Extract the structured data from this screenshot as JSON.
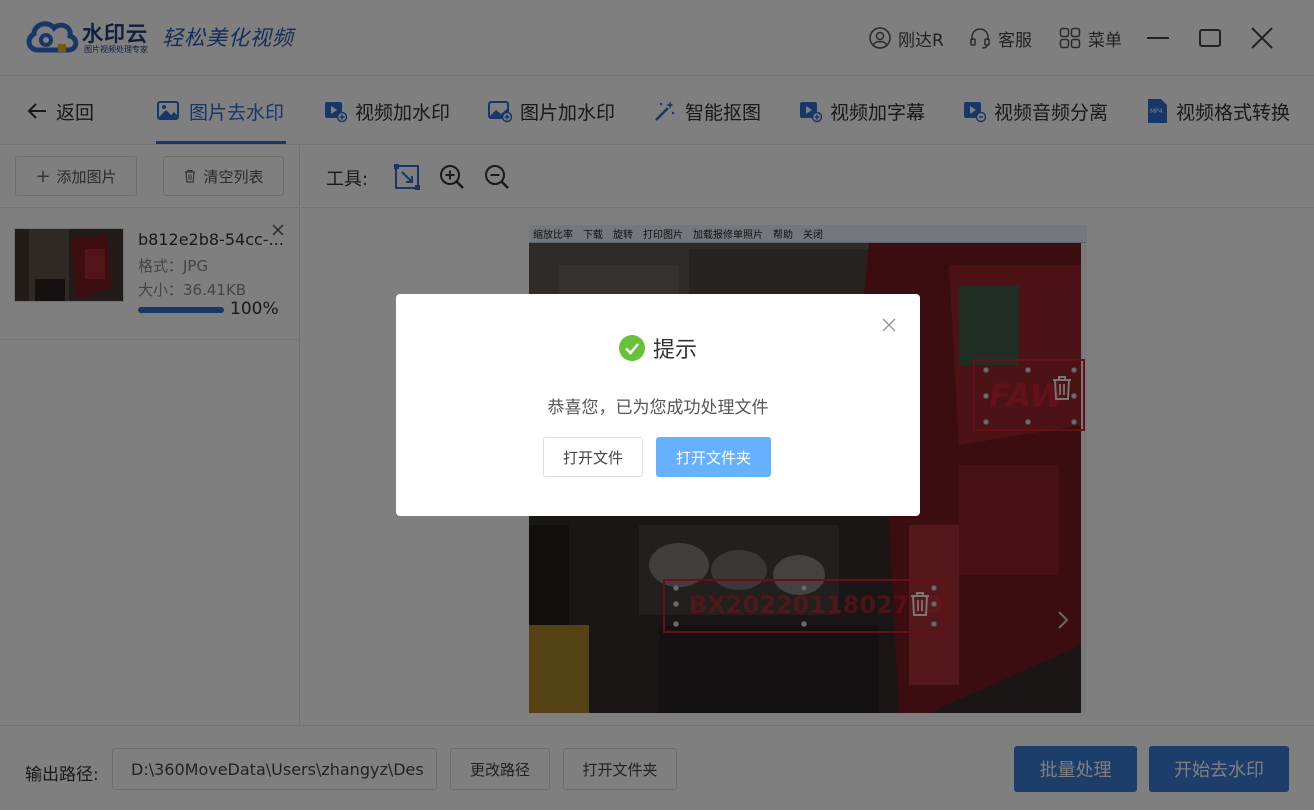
{
  "titlebar": {
    "brand_name": "水印云",
    "brand_sub": "图片视频处理专家",
    "slogan": "轻松美化视频",
    "user_name": "刚达R",
    "service_label": "客服",
    "menu_label": "菜单"
  },
  "tabs": {
    "back_label": "返回",
    "items": [
      {
        "label": "图片去水印"
      },
      {
        "label": "视频加水印"
      },
      {
        "label": "图片加水印"
      },
      {
        "label": "智能抠图"
      },
      {
        "label": "视频加字幕"
      },
      {
        "label": "视频音频分离"
      },
      {
        "label": "视频格式转换"
      }
    ],
    "active_index": 0
  },
  "sidebar": {
    "add_image_label": "添加图片",
    "clear_list_label": "清空列表",
    "files": [
      {
        "name": "b812e2b8-54cc-...",
        "format": "格式：JPG",
        "size": "大小：36.41KB",
        "progress_text": "100%",
        "progress": 1.0
      }
    ]
  },
  "toolbar": {
    "label": "工具:"
  },
  "preview": {
    "viewer_items": [
      "缩放比率",
      "下载",
      "旋转",
      "打印图片",
      "加载报修单照片",
      "帮助",
      "关闭"
    ],
    "watermark_1_text": "FAW",
    "watermark_2_text": "BX20220118027a9"
  },
  "bottom": {
    "output_label": "输出路径:",
    "output_path": "D:\\360MoveData\\Users\\zhangyz\\Des",
    "change_path_label": "更改路径",
    "open_folder_label": "打开文件夹",
    "batch_label": "批量处理",
    "start_label": "开始去水印"
  },
  "dialog": {
    "title": "提示",
    "message": "恭喜您，已为您成功处理文件",
    "open_file_label": "打开文件",
    "open_folder_label": "打开文件夹"
  },
  "colors": {
    "accent": "#2f6fd3",
    "primary_button": "#3a7bd5",
    "dialog_primary": "#66b1ff",
    "success": "#67c23a",
    "watermark_box": "#d0202a"
  }
}
